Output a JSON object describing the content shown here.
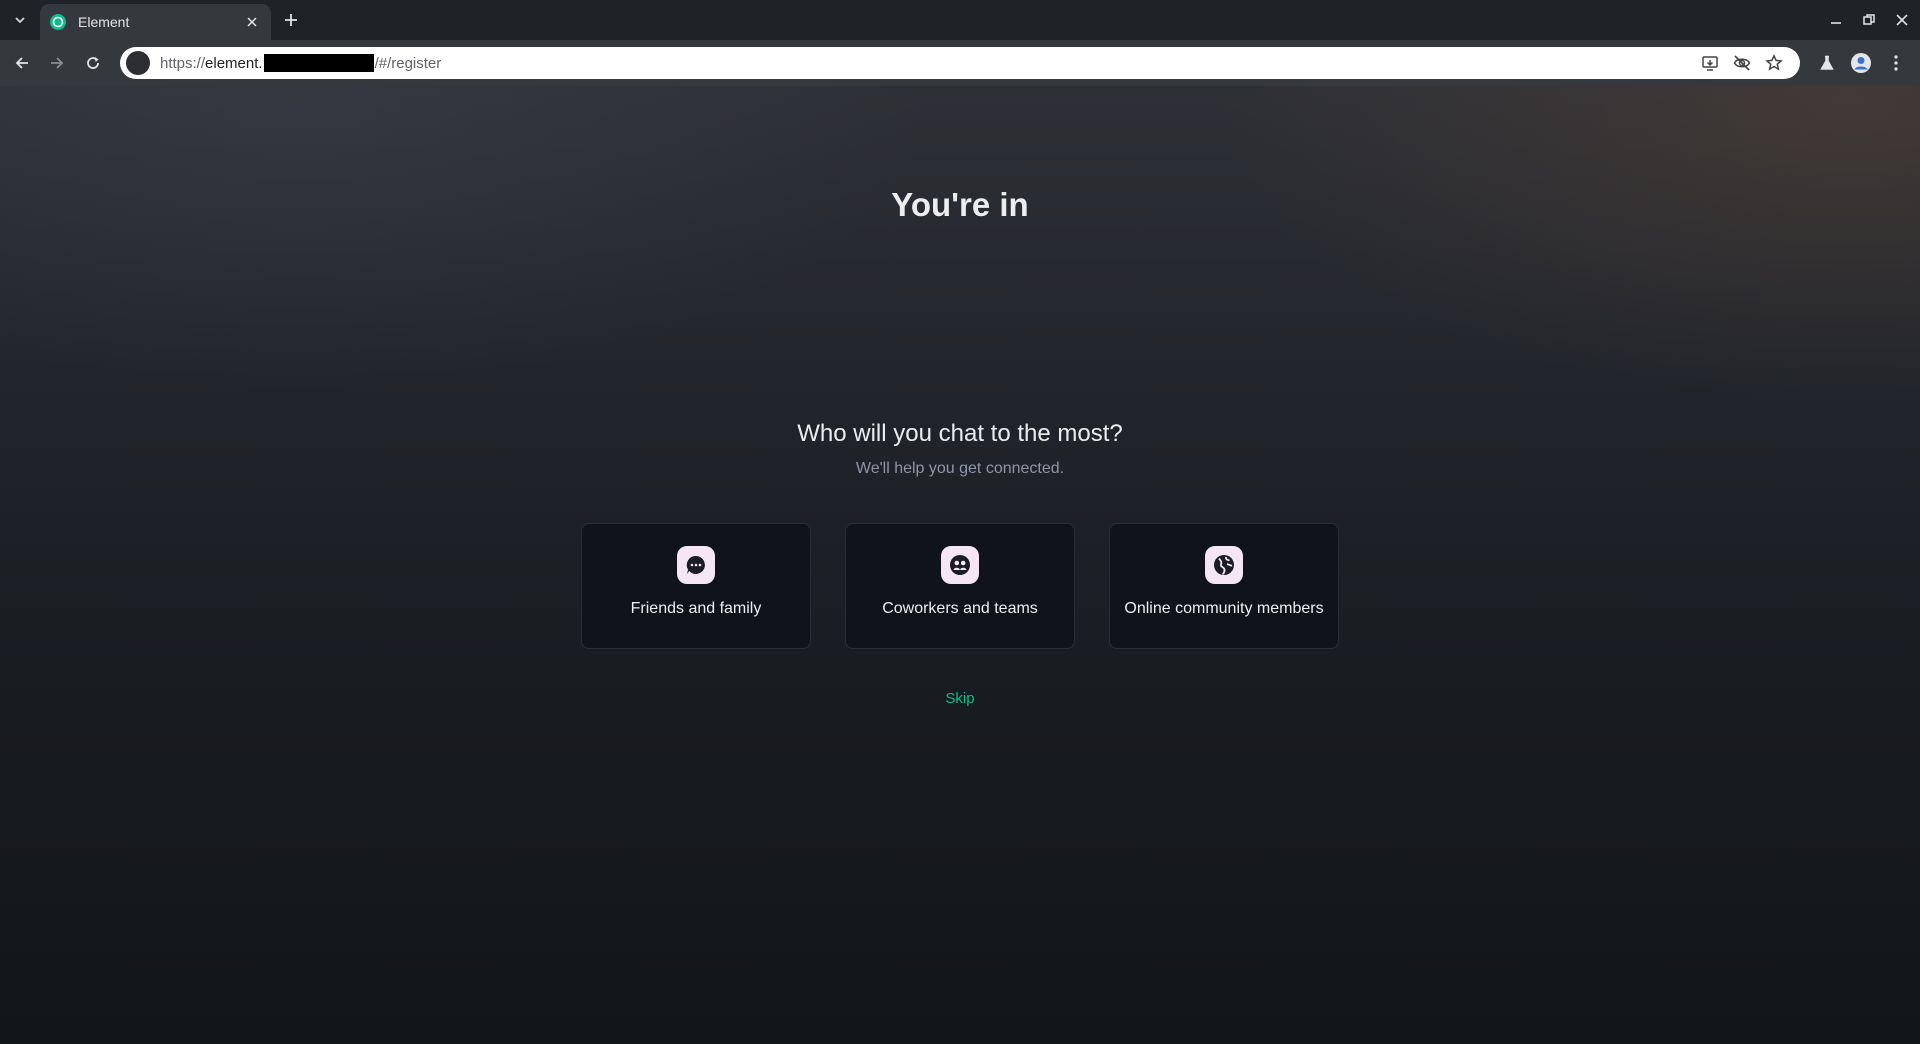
{
  "browser": {
    "tab": {
      "title": "Element"
    },
    "address": {
      "scheme": "https://",
      "host_visible": "element.",
      "path": "/#/register"
    }
  },
  "page": {
    "heading": "You're in",
    "question": "Who will you chat to the most?",
    "subtext": "We'll help you get connected.",
    "options": [
      {
        "label": "Friends and family",
        "icon": "chat-bubble-icon"
      },
      {
        "label": "Coworkers and teams",
        "icon": "team-icon"
      },
      {
        "label": "Online community members",
        "icon": "globe-icon"
      }
    ],
    "skip_label": "Skip"
  },
  "colors": {
    "accent": "#0dbd8b",
    "card_icon_bg": "#f4e7f3",
    "card_bg": "#10131a"
  }
}
